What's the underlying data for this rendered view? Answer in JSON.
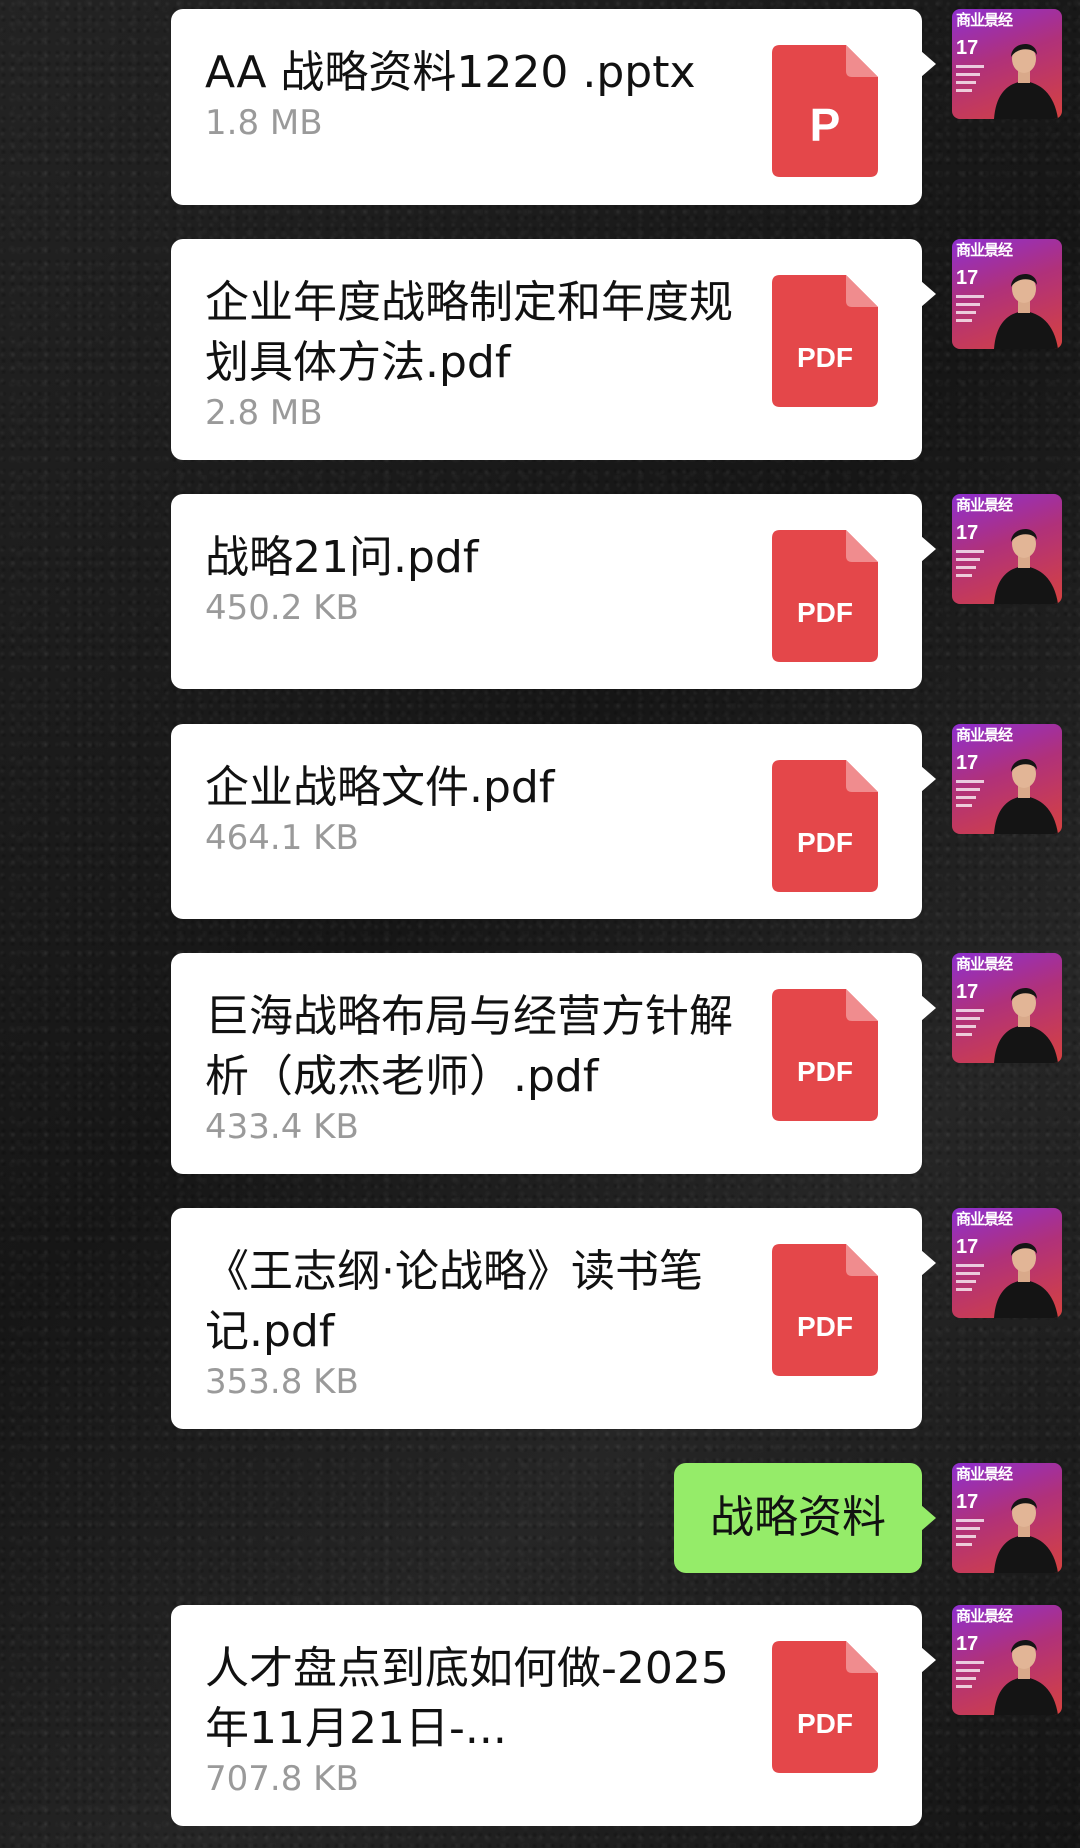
{
  "messages": [
    {
      "type": "file",
      "name": "AA 战略资料1220 .pptx",
      "size": "1.8 MB",
      "icon_label": "P",
      "icon_name": "pptx-file-icon"
    },
    {
      "type": "file",
      "name": "企业年度战略制定和年度规划具体方法.pdf",
      "size": "2.8 MB",
      "icon_label": "PDF",
      "icon_name": "pdf-file-icon"
    },
    {
      "type": "file",
      "name": "战略21问.pdf",
      "size": "450.2 KB",
      "icon_label": "PDF",
      "icon_name": "pdf-file-icon"
    },
    {
      "type": "file",
      "name": "企业战略文件.pdf",
      "size": "464.1 KB",
      "icon_label": "PDF",
      "icon_name": "pdf-file-icon"
    },
    {
      "type": "file",
      "name": "巨海战略布局与经营方针解析（成杰老师）.pdf",
      "size": "433.4 KB",
      "icon_label": "PDF",
      "icon_name": "pdf-file-icon"
    },
    {
      "type": "file",
      "name": "《王志纲·论战略》读书笔记.pdf",
      "size": "353.8 KB",
      "icon_label": "PDF",
      "icon_name": "pdf-file-icon"
    },
    {
      "type": "text",
      "text": "战略资料"
    },
    {
      "type": "file",
      "name": "人才盘点到底如何做-2025年11月21日-...",
      "size": "707.8 KB",
      "icon_label": "PDF",
      "icon_name": "pdf-file-icon"
    }
  ],
  "avatar": {
    "magazine_title": "商业景经",
    "issue": "17"
  },
  "colors": {
    "file_icon_red": "#e4474a",
    "file_icon_fold": "#f08c8e",
    "sent_bubble": "#95ec69",
    "file_card": "#ffffff",
    "size_text": "#9a9a9a"
  }
}
